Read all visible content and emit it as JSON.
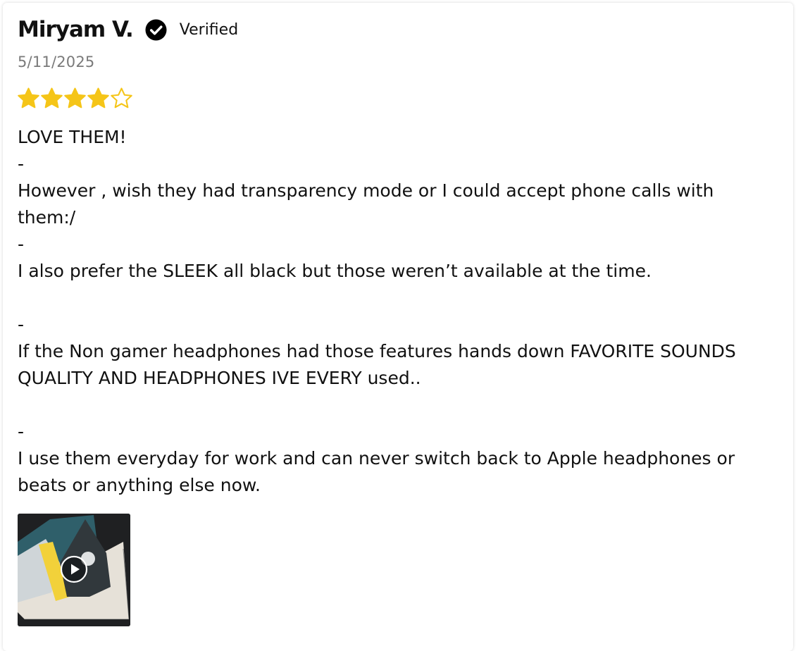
{
  "review": {
    "author": "Miryam V.",
    "verified_label": "Verified",
    "date": "5/11/2025",
    "rating": 4,
    "rating_max": 5,
    "star_color": "#F5C518",
    "icons": {
      "verified": "check-circle-icon",
      "star": "star-icon",
      "play": "play-icon"
    },
    "body_lines": [
      "LOVE THEM!",
      "-",
      "However , wish they had transparency mode or I could accept phone calls with them:/",
      "-",
      "I also prefer the SLEEK all black but those weren’t available at the time.",
      "",
      "-",
      "If the Non gamer headphones had those features hands down FAVORITE SOUNDS QUALITY AND HEADPHONES IVE EVERY used..",
      "",
      "-",
      "I use them everyday for work and can never switch back to Apple headphones or beats or anything else now."
    ]
  }
}
